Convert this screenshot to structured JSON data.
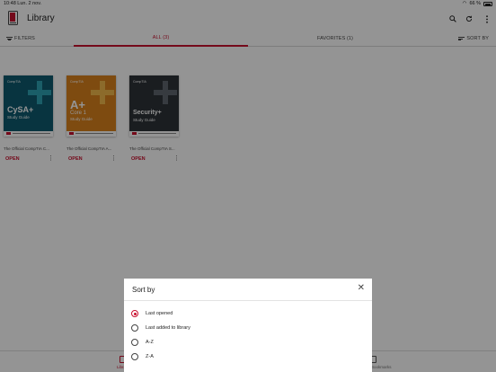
{
  "status_bar": {
    "time": "10:48",
    "date": "Lun. 2 nov.",
    "battery": "66 %"
  },
  "header": {
    "title": "Library"
  },
  "icons": {
    "app": "library-app-icon",
    "search": "search-icon",
    "refresh": "refresh-icon",
    "more": "more-vertical-icon"
  },
  "tabs": {
    "filters": "FILTERS",
    "all": "ALL (3)",
    "favorites": "FAVORITES (1)",
    "sort": "SORT BY"
  },
  "books": [
    {
      "brand": "CompTIA",
      "cover_main": "CySA+",
      "cover_sub": "Study Guide",
      "title": "The Official CompTIA C...",
      "open": "OPEN",
      "color": "#0e5b6e",
      "accent": "#2ea3b3"
    },
    {
      "brand": "CompTIA",
      "cover_main": "A+",
      "cover_line2": "Core 1",
      "cover_sub": "Study Guide",
      "title": "The Official CompTIA A...",
      "open": "OPEN",
      "color": "#d9811c",
      "accent": "#f2b84b"
    },
    {
      "brand": "CompTIA",
      "cover_main": "Security+",
      "cover_sub": "Study Guide",
      "title": "The Official CompTIA S...",
      "open": "OPEN",
      "color": "#2d3238",
      "accent": "#5f666e"
    }
  ],
  "bottom_nav": {
    "library": "Library",
    "right": "Bookmarks"
  },
  "sort_dialog": {
    "title": "Sort by",
    "options": [
      "Last opened",
      "Last added to library",
      "A-Z",
      "Z-A"
    ],
    "selected": "Last opened"
  },
  "colors": {
    "accent": "#c8102e"
  }
}
